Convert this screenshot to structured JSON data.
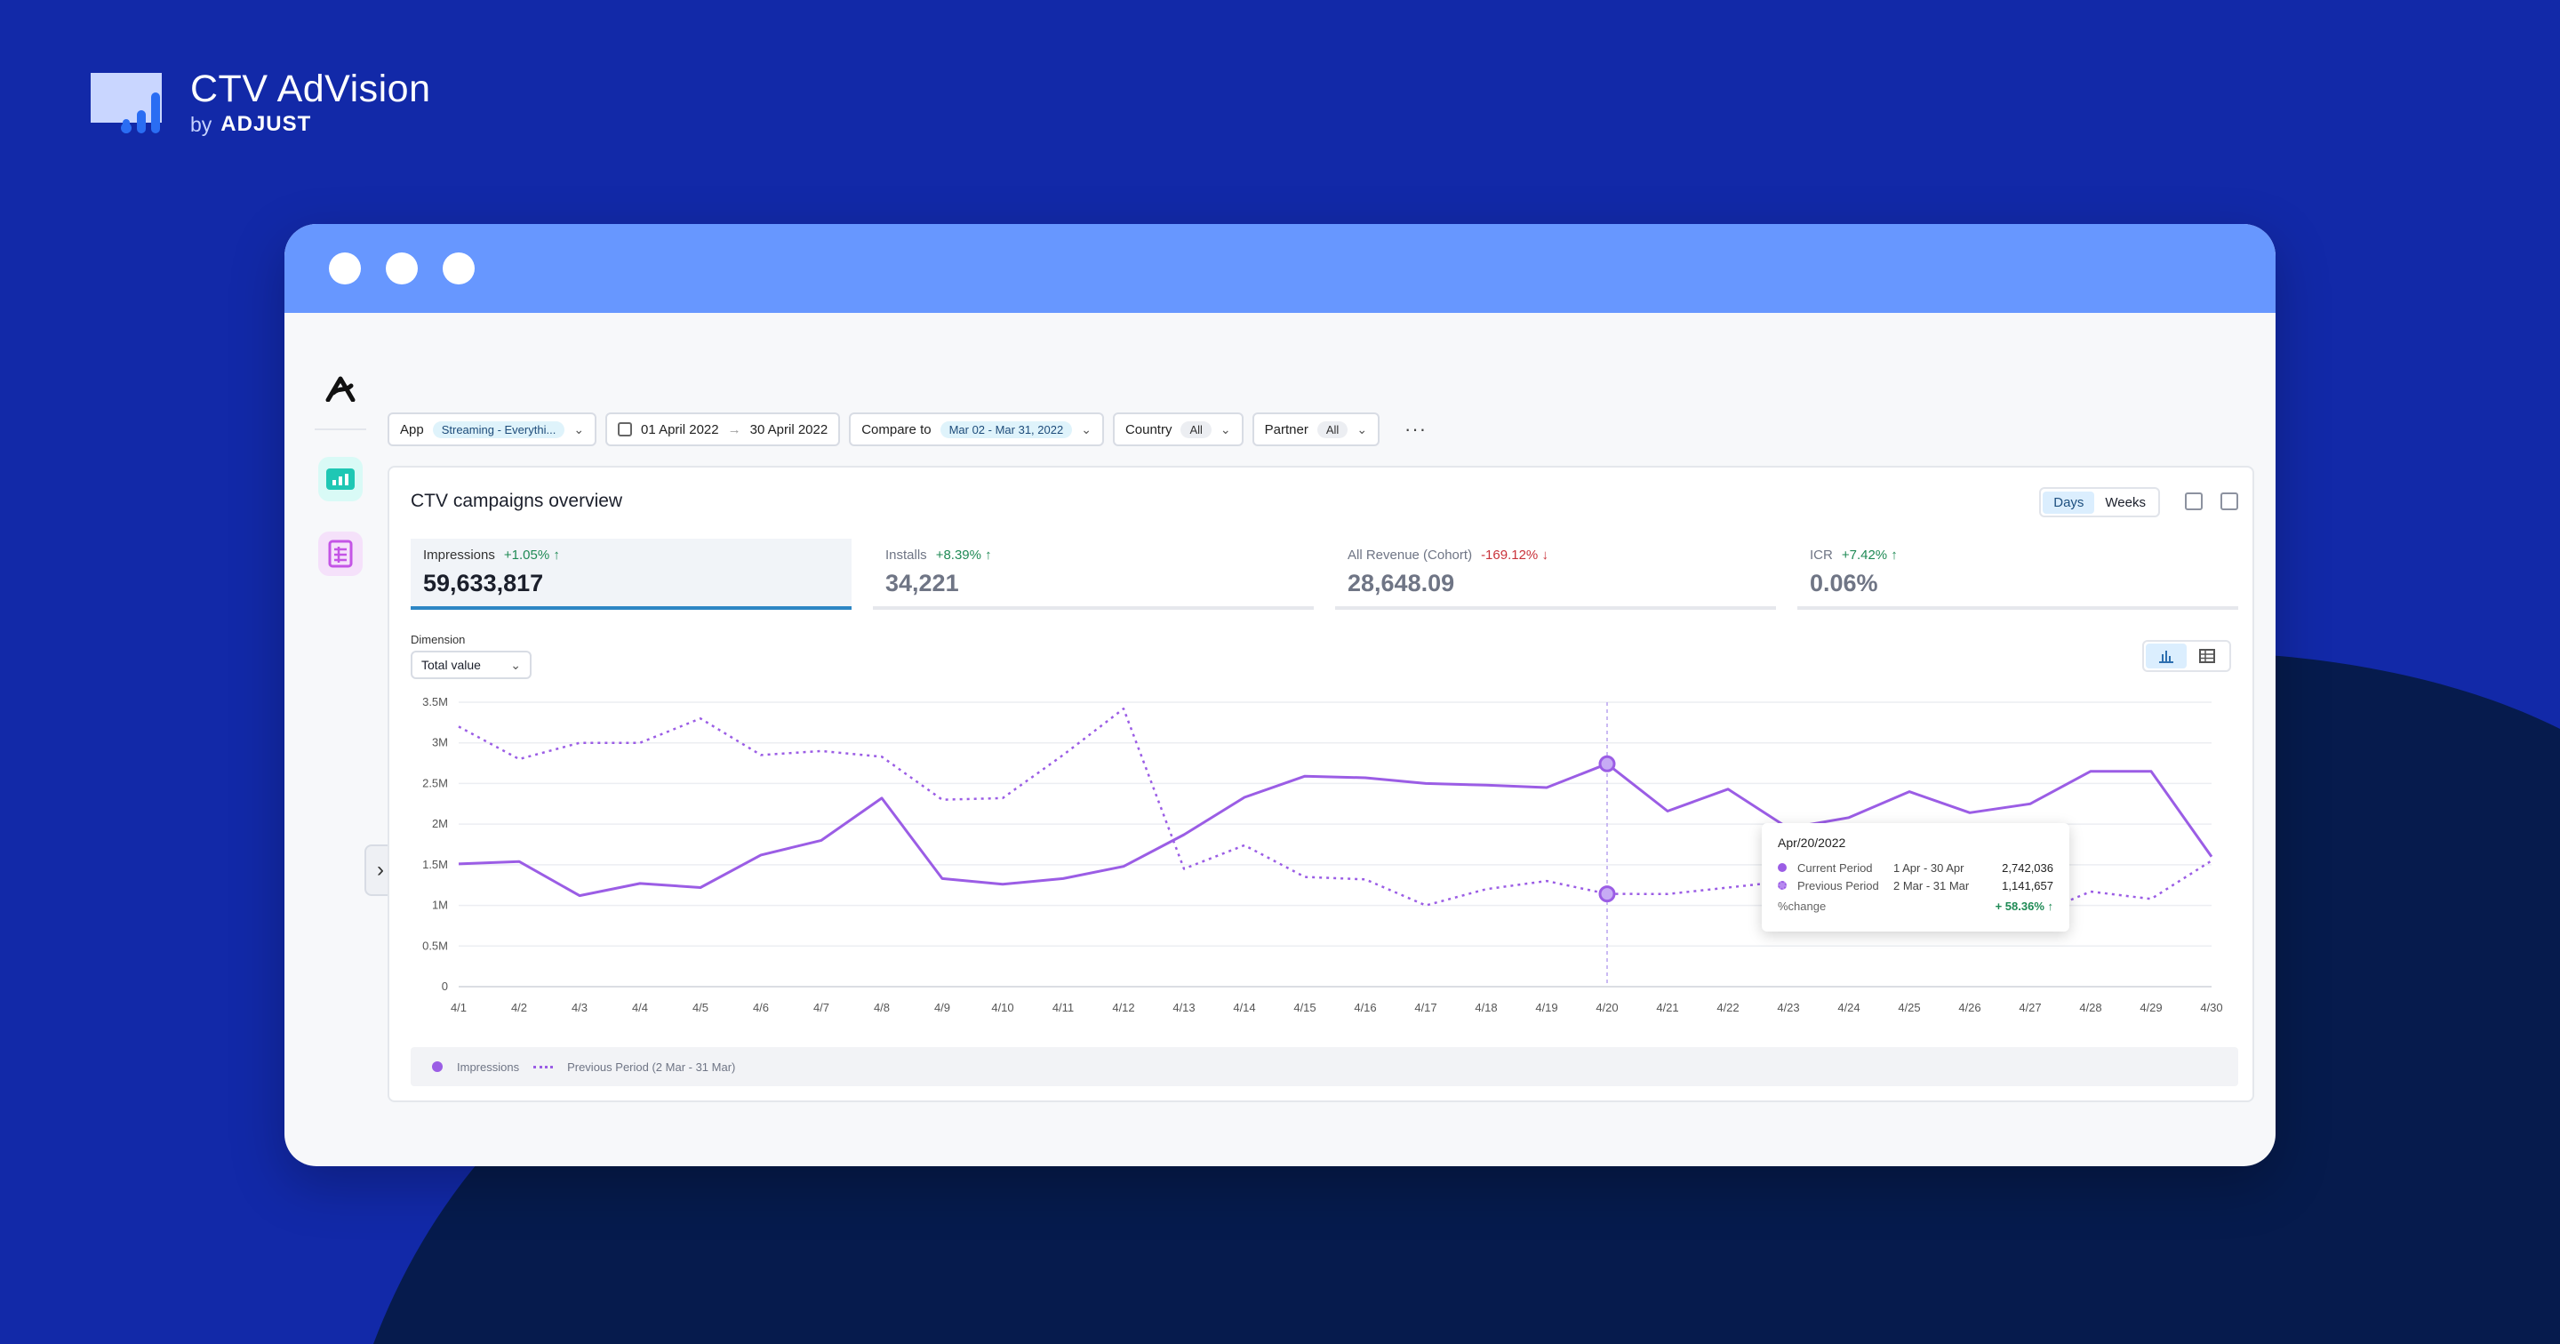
{
  "brand": {
    "title": "CTV AdVision",
    "by": "by",
    "company": "ADJUST"
  },
  "app": {
    "logo_icon": "adjust-a-icon"
  },
  "rail": {
    "items": [
      {
        "icon": "bar-chart-icon",
        "color": "#1fc7b4"
      },
      {
        "icon": "spreadsheet-icon",
        "color": "#c454e6"
      }
    ]
  },
  "filters": {
    "app_label": "App",
    "app_value": "Streaming - Everythi...",
    "date_from": "01 April 2022",
    "date_to": "30 April 2022",
    "compare_label": "Compare to",
    "compare_value": "Mar 02 - Mar 31, 2022",
    "country_label": "Country",
    "country_value": "All",
    "partner_label": "Partner",
    "partner_value": "All",
    "more": "···"
  },
  "card": {
    "title": "CTV campaigns overview",
    "days": "Days",
    "weeks": "Weeks"
  },
  "metrics": [
    {
      "label": "Impressions",
      "delta": "+1.05%",
      "dir": "up",
      "value": "59,633,817"
    },
    {
      "label": "Installs",
      "delta": "+8.39%",
      "dir": "up",
      "value": "34,221"
    },
    {
      "label": "All Revenue (Cohort)",
      "delta": "-169.12%",
      "dir": "down",
      "value": "28,648.09"
    },
    {
      "label": "ICR",
      "delta": "+7.42%",
      "dir": "up",
      "value": "0.06%"
    }
  ],
  "dimension": {
    "label": "Dimension",
    "value": "Total value"
  },
  "tooltip": {
    "date": "Apr/20/2022",
    "current_name": "Current Period",
    "current_range": "1 Apr - 30 Apr",
    "current_value": "2,742,036",
    "previous_name": "Previous Period",
    "previous_range": "2 Mar - 31 Mar",
    "previous_value": "1,141,657",
    "change_label": "%change",
    "change_value": "+ 58.36%"
  },
  "legend": {
    "current": "Impressions",
    "previous": "Previous Period (2 Mar - 31 Mar)"
  },
  "colors": {
    "series": "#9b5de5",
    "accent": "#2d86c4",
    "up": "#1f8a55",
    "down": "#c9323a"
  },
  "chart_data": {
    "type": "line",
    "categories": [
      "4/1",
      "4/2",
      "4/3",
      "4/4",
      "4/5",
      "4/6",
      "4/7",
      "4/8",
      "4/9",
      "4/10",
      "4/11",
      "4/12",
      "4/13",
      "4/14",
      "4/15",
      "4/16",
      "4/17",
      "4/18",
      "4/19",
      "4/20",
      "4/21",
      "4/22",
      "4/23",
      "4/24",
      "4/25",
      "4/26",
      "4/27",
      "4/28",
      "4/29",
      "4/30"
    ],
    "y_ticks": [
      "0",
      "0.5M",
      "1M",
      "1.5M",
      "2M",
      "2.5M",
      "3M",
      "3.5M"
    ],
    "ylim": [
      0,
      3500000
    ],
    "grid": true,
    "legend_position": "bottom",
    "series": [
      {
        "name": "Impressions",
        "style": "solid",
        "values": [
          1510000,
          1540000,
          1120000,
          1270000,
          1220000,
          1620000,
          1800000,
          2320000,
          1330000,
          1260000,
          1330000,
          1480000,
          1870000,
          2330000,
          2590000,
          2570000,
          2500000,
          2480000,
          2450000,
          2742036,
          2160000,
          2430000,
          1950000,
          2080000,
          2400000,
          2140000,
          2250000,
          2650000,
          2650000,
          1600000
        ]
      },
      {
        "name": "Previous Period (2 Mar - 31 Mar)",
        "style": "dotted",
        "values": [
          3200000,
          2800000,
          3000000,
          3000000,
          3300000,
          2850000,
          2900000,
          2830000,
          2300000,
          2320000,
          2850000,
          3420000,
          1450000,
          1740000,
          1350000,
          1320000,
          1000000,
          1200000,
          1300000,
          1141657,
          1140000,
          1220000,
          1300000,
          1500000,
          1800000,
          1920000,
          860000,
          1170000,
          1080000,
          1550000
        ]
      }
    ]
  }
}
